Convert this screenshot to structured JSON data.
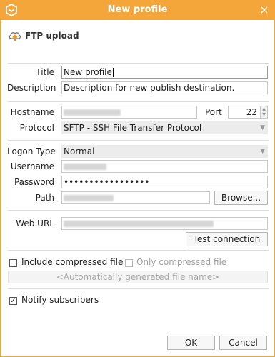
{
  "window": {
    "title": "New profile",
    "close_glyph": "×",
    "accent": "#f4a63a"
  },
  "header": {
    "title": "FTP upload",
    "icon": "cloud-upload-icon"
  },
  "form": {
    "title_label": "Title",
    "title_value": "New profile",
    "description_label": "Description",
    "description_value": "Description for new publish destination.",
    "hostname_label": "Hostname",
    "port_label": "Port",
    "port_value": "22",
    "protocol_label": "Protocol",
    "protocol_value": "SFTP - SSH File Transfer Protocol",
    "logon_type_label": "Logon Type",
    "logon_type_value": "Normal",
    "username_label": "Username",
    "password_label": "Password",
    "password_value": "•••••••••••••••••",
    "path_label": "Path",
    "browse_label": "Browse...",
    "web_url_label": "Web URL",
    "test_connection_label": "Test connection",
    "include_compressed_label": "Include compressed file",
    "include_compressed_checked": false,
    "only_compressed_label": "Only compressed file",
    "only_compressed_checked": false,
    "auto_name_placeholder": "<Automatically generated file name>",
    "notify_label": "Notify subscribers",
    "notify_checked": true,
    "notify_check_glyph": "✓"
  },
  "footer": {
    "ok_label": "OK",
    "cancel_label": "Cancel"
  }
}
